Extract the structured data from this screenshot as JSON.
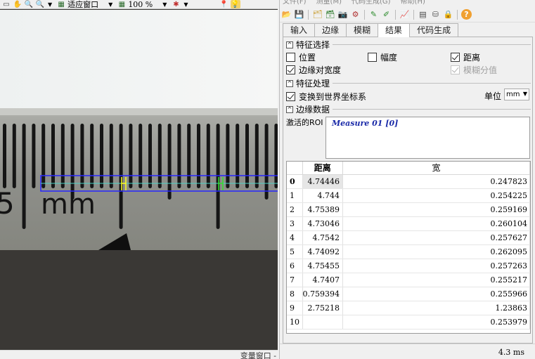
{
  "viewer": {
    "toolbar": {
      "fit_label": "适应窗口",
      "zoom_label": "100 %"
    },
    "status_label": "变量窗口 -",
    "ruler_unit": "mm",
    "ruler_digit": "5"
  },
  "panel": {
    "menu": [
      "文件(F)",
      "测量(M)",
      "代码生成(G)",
      "帮助(H)"
    ],
    "tabs": [
      "输入",
      "边缘",
      "模糊",
      "结果",
      "代码生成"
    ],
    "active_tab": "结果",
    "feature_selection": {
      "title": "特征选择",
      "position": "位置",
      "amplitude": "幅度",
      "distance": "距离",
      "edge_pair_width": "边缘对宽度",
      "fuzzy_score": "模糊分值"
    },
    "feature_processing": {
      "title": "特征处理",
      "transform_world": "变换到世界坐标系",
      "unit_label": "单位",
      "unit_value": "mm"
    },
    "edge_data": {
      "title": "边缘数据",
      "roi_label": "激活的ROI",
      "roi_value": "Measure 01 [0]",
      "columns": [
        "距离",
        "宽"
      ],
      "rows": [
        {
          "idx": "0",
          "distance": "4.74446",
          "width": "0.247823"
        },
        {
          "idx": "1",
          "distance": "4.744",
          "width": "0.254225"
        },
        {
          "idx": "2",
          "distance": "4.75389",
          "width": "0.259169"
        },
        {
          "idx": "3",
          "distance": "4.73046",
          "width": "0.260104"
        },
        {
          "idx": "4",
          "distance": "4.7542",
          "width": "0.257627"
        },
        {
          "idx": "5",
          "distance": "4.74092",
          "width": "0.262095"
        },
        {
          "idx": "6",
          "distance": "4.75455",
          "width": "0.257263"
        },
        {
          "idx": "7",
          "distance": "4.7407",
          "width": "0.255217"
        },
        {
          "idx": "8",
          "distance": "0.759394",
          "width": "0.255966"
        },
        {
          "idx": "9",
          "distance": "2.75218",
          "width": "1.23863"
        },
        {
          "idx": "10",
          "distance": "",
          "width": "0.253979"
        }
      ]
    },
    "status_time": "4.3 ms"
  }
}
